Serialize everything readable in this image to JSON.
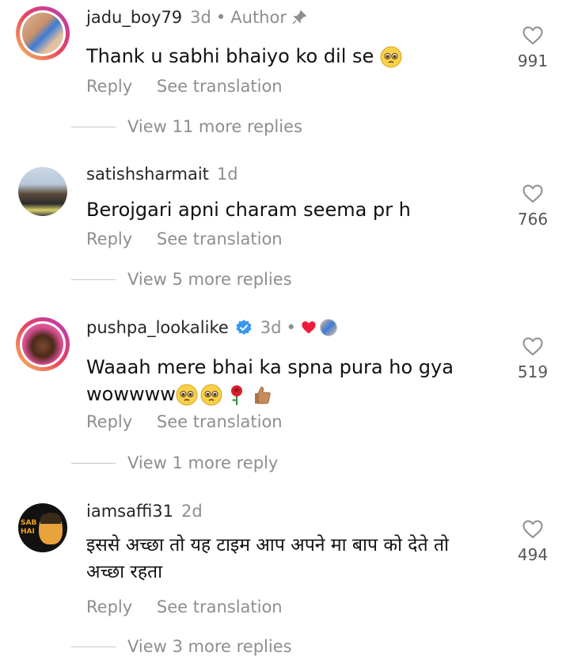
{
  "comments": [
    {
      "username": "jadu_boy79",
      "age": "3d",
      "badge": "Author",
      "text": "Thank u sabhi bhaiyo ko dil se",
      "emojis": [
        "pleading-face"
      ],
      "reply_label": "Reply",
      "translate_label": "See translation",
      "view_replies": "View 11 more replies",
      "likes": "991"
    },
    {
      "username": "satishsharmait",
      "age": "1d",
      "text": "Berojgari apni charam seema pr h",
      "reply_label": "Reply",
      "translate_label": "See translation",
      "view_replies": "View 5 more replies",
      "likes": "766"
    },
    {
      "username": "pushpa_lookalike",
      "age": "3d",
      "text_line1": "Waaah mere bhai ka spna pura ho gya",
      "text_line2": "wowwww",
      "emojis": [
        "pleading-face",
        "pleading-face",
        "rose",
        "thumbs-up"
      ],
      "reply_label": "Reply",
      "translate_label": "See translation",
      "view_replies": "View 1 more reply",
      "likes": "519"
    },
    {
      "username": "iamsaffi31",
      "age": "2d",
      "avatar_text": "SAB HAI",
      "text_line1": "इससे अच्छा तो यह टाइम आप अपने मा बाप को देते तो",
      "text_line2": "अच्छा रहता",
      "reply_label": "Reply",
      "translate_label": "See translation",
      "view_replies": "View 3 more replies",
      "likes": "494"
    }
  ],
  "colors": {
    "text": "#111111",
    "muted": "#8e8e8e",
    "verified": "#3897f0",
    "heart": "#ed1c3a"
  }
}
